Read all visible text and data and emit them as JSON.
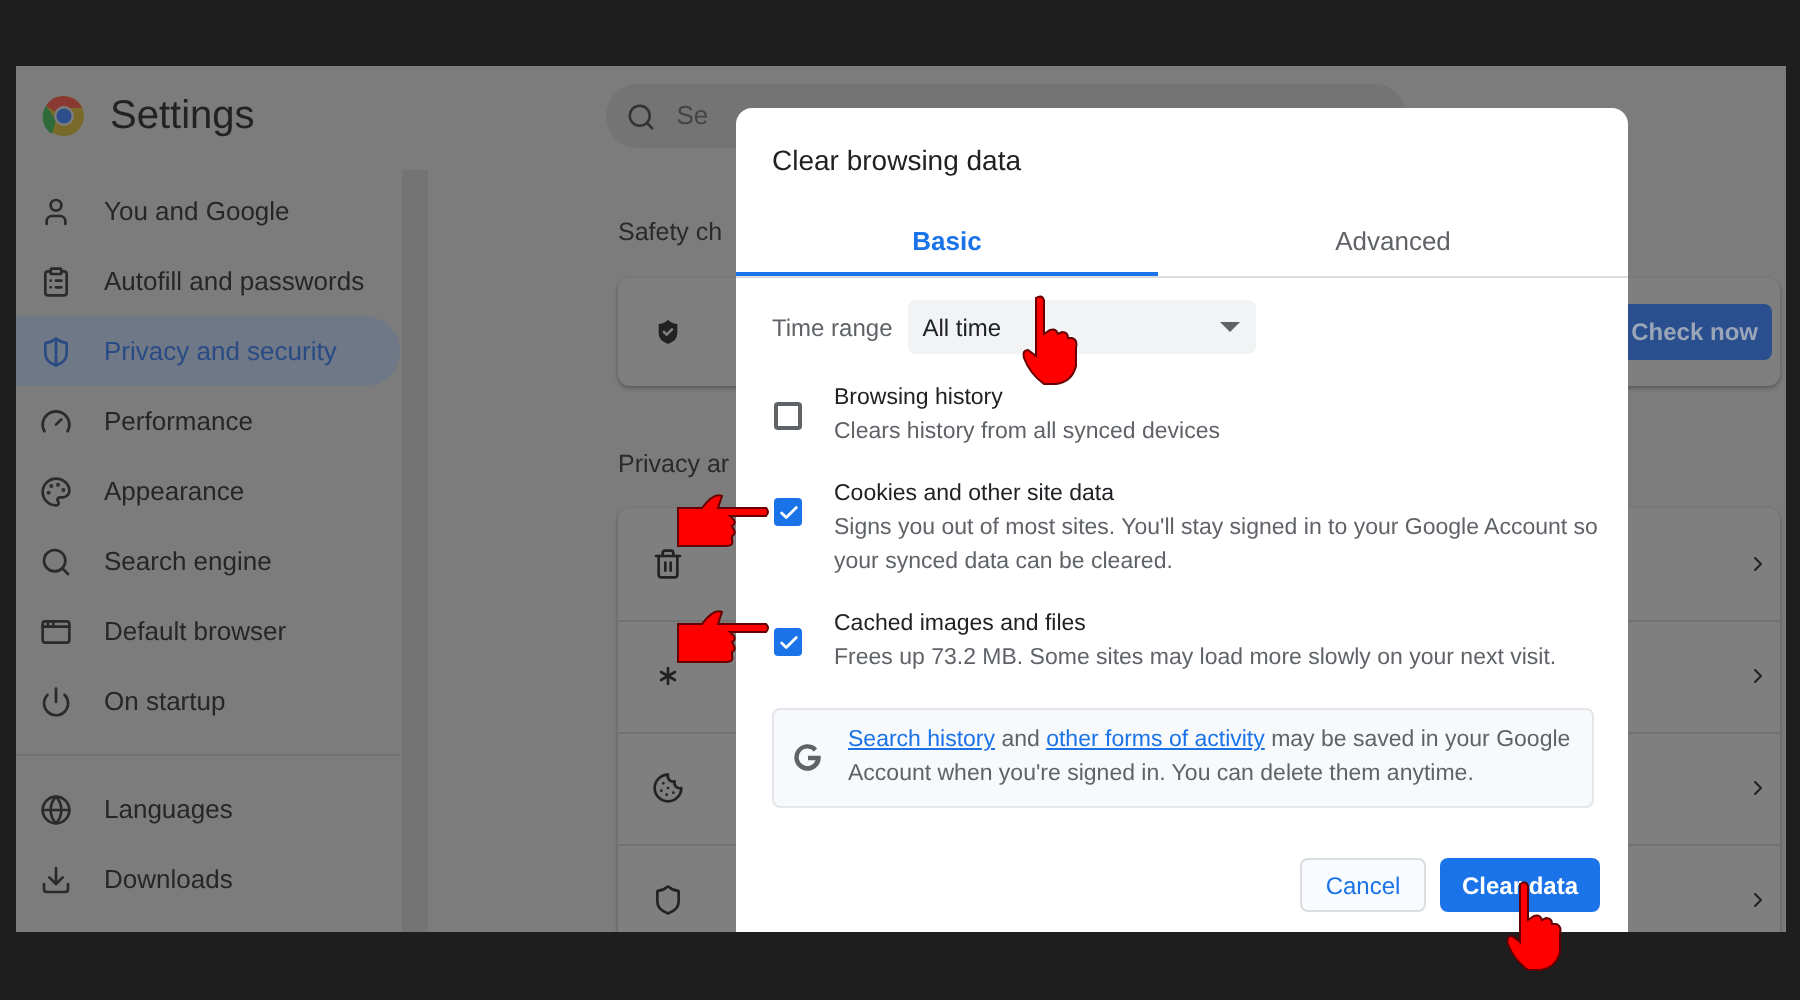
{
  "window": {
    "title": "Settings"
  },
  "search": {
    "placeholder": "Se"
  },
  "sidebar": {
    "items": [
      {
        "label": "You and Google",
        "selected": false
      },
      {
        "label": "Autofill and passwords",
        "selected": false
      },
      {
        "label": "Privacy and security",
        "selected": true
      },
      {
        "label": "Performance",
        "selected": false
      },
      {
        "label": "Appearance",
        "selected": false
      },
      {
        "label": "Search engine",
        "selected": false
      },
      {
        "label": "Default browser",
        "selected": false
      },
      {
        "label": "On startup",
        "selected": false
      },
      {
        "label": "Languages",
        "selected": false
      },
      {
        "label": "Downloads",
        "selected": false
      }
    ]
  },
  "main": {
    "safety_heading": "Safety ch",
    "check_button": "Check now",
    "privacy_heading": "Privacy ar"
  },
  "dialog": {
    "title": "Clear browsing data",
    "tabs": [
      {
        "label": "Basic",
        "selected": true
      },
      {
        "label": "Advanced",
        "selected": false
      }
    ],
    "time_range": {
      "label": "Time range",
      "value": "All time"
    },
    "options": [
      {
        "title": "Browsing history",
        "description": "Clears history from all synced devices",
        "checked": false
      },
      {
        "title": "Cookies and other site data",
        "description": "Signs you out of most sites. You'll stay signed in to your Google Account so your synced data can be cleared.",
        "checked": true
      },
      {
        "title": "Cached images and files",
        "description": "Frees up 73.2 MB. Some sites may load more slowly on your next visit.",
        "checked": true
      }
    ],
    "notice": [
      {
        "text": "Search history",
        "link": true
      },
      {
        "text": " and ",
        "link": false
      },
      {
        "text": "other forms of activity",
        "link": true
      },
      {
        "text": " may be saved in your Google Account when you're signed in. You can delete them anytime.",
        "link": false
      }
    ],
    "buttons": [
      {
        "label": "Cancel",
        "kind": "secondary"
      },
      {
        "label": "Clear data",
        "kind": "primary"
      }
    ]
  }
}
